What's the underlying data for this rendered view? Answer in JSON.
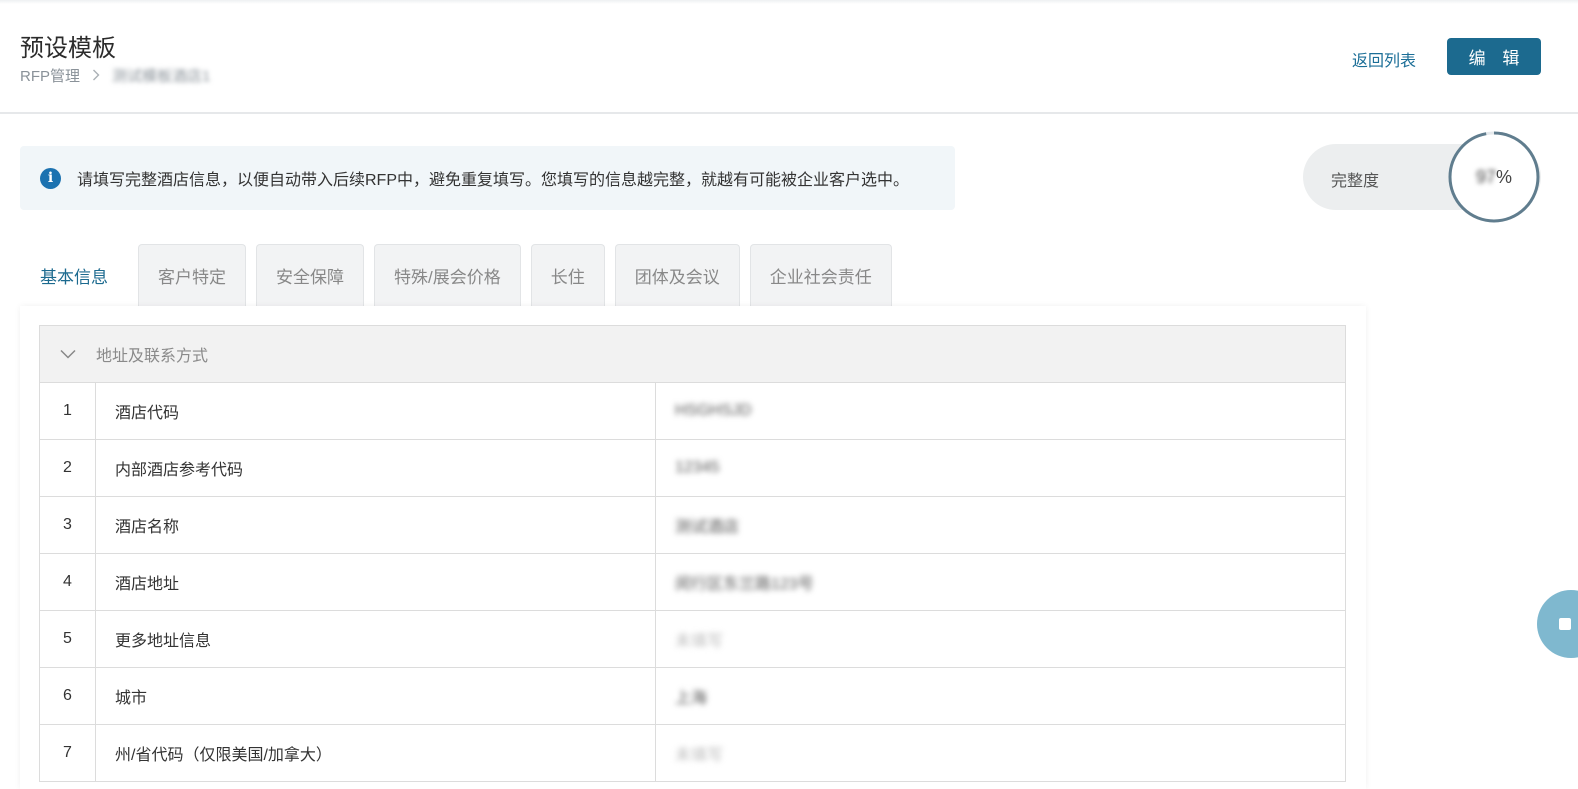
{
  "header": {
    "title": "预设模板",
    "breadcrumb_root": "RFP管理",
    "breadcrumb_current": "测试模板酒店1",
    "back_link": "返回列表",
    "edit_button": "编 辑"
  },
  "info": {
    "icon": "info-icon",
    "text": "请填写完整酒店信息，以便自动带入后续RFP中，避免重复填写。您填写的信息越完整，就越有可能被企业客户选中。"
  },
  "completeness": {
    "label": "完整度",
    "value": "97",
    "unit": "%",
    "fraction": 0.97
  },
  "tabs": [
    {
      "label": "基本信息",
      "active": true
    },
    {
      "label": "客户特定",
      "active": false
    },
    {
      "label": "安全保障",
      "active": false
    },
    {
      "label": "特殊/展会价格",
      "active": false
    },
    {
      "label": "长住",
      "active": false
    },
    {
      "label": "团体及会议",
      "active": false
    },
    {
      "label": "企业社会责任",
      "active": false
    }
  ],
  "section": {
    "title": "地址及联系方式",
    "rows": [
      {
        "num": "1",
        "label": "酒店代码",
        "value": "HSGHSJD",
        "placeholder": false
      },
      {
        "num": "2",
        "label": "内部酒店参考代码",
        "value": "12345",
        "placeholder": false
      },
      {
        "num": "3",
        "label": "酒店名称",
        "value": "测试酒店",
        "placeholder": false
      },
      {
        "num": "4",
        "label": "酒店地址",
        "value": "闵行区东兰路123号",
        "placeholder": false
      },
      {
        "num": "5",
        "label": "更多地址信息",
        "value": "未填写",
        "placeholder": true
      },
      {
        "num": "6",
        "label": "城市",
        "value": "上海",
        "placeholder": false
      },
      {
        "num": "7",
        "label": "州/省代码（仅限美国/加拿大）",
        "value": "未填写",
        "placeholder": true
      }
    ]
  },
  "colors": {
    "accent": "#1c6a8f",
    "info_bg": "#f1f6f9",
    "link": "#1b6e97"
  }
}
